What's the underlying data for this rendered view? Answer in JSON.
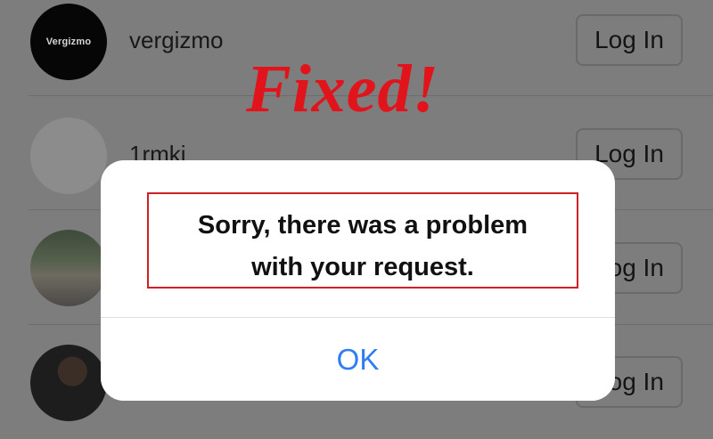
{
  "accounts": [
    {
      "username": "vergizmo",
      "avatar_text": "Vergizmo",
      "action": "Log In"
    },
    {
      "username": "1rmki",
      "action": "Log In"
    },
    {
      "username": "",
      "action": "Log In"
    },
    {
      "username": "",
      "action": "Log In"
    }
  ],
  "banner": {
    "text": "Fixed!",
    "color": "#e1141b"
  },
  "dialog": {
    "message_line1": "Sorry, there was a problem",
    "message_line2": "with your request.",
    "ok_label": "OK",
    "accent_color": "#2f7df6"
  }
}
